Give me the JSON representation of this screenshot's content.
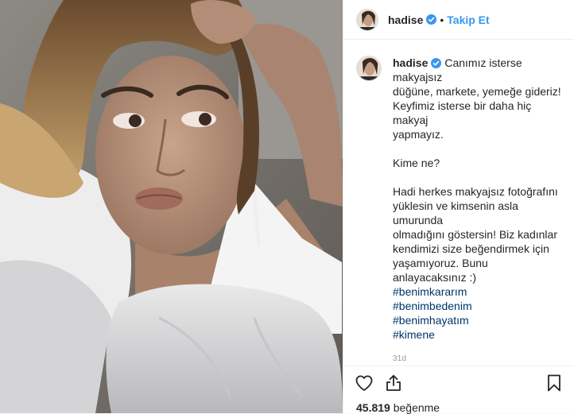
{
  "post": {
    "username": "hadise",
    "follow_label": "Takip Et",
    "separator": "•",
    "caption": {
      "lines1": [
        "Canımız isterse makyajsız",
        "düğüne, markete, yemeğe gideriz!",
        "Keyfimiz isterse bir daha hiç makyaj",
        "yapmayız."
      ],
      "line2": "Kime ne?",
      "lines3": [
        "Hadi herkes makyajsız fotoğrafını",
        "yüklesin ve kimsenin asla umurunda",
        "olmadığını göstersin! Biz kadınlar",
        "kendimizi size beğendirmek için",
        "yaşamıyoruz. Bunu anlayacaksınız :)"
      ],
      "hashtags": [
        "#benimkararım",
        "#benimbedenim",
        "#benimhayatım",
        "#kimene"
      ]
    },
    "time": "31d",
    "likes_count": "45.819",
    "likes_label": "beğenme"
  },
  "icons": {
    "verified": "verified-badge-icon",
    "like": "heart-icon",
    "share": "share-icon",
    "save": "bookmark-icon"
  },
  "colors": {
    "link": "#3897f0",
    "hashtag": "#003569",
    "verified": "#3897f0"
  }
}
